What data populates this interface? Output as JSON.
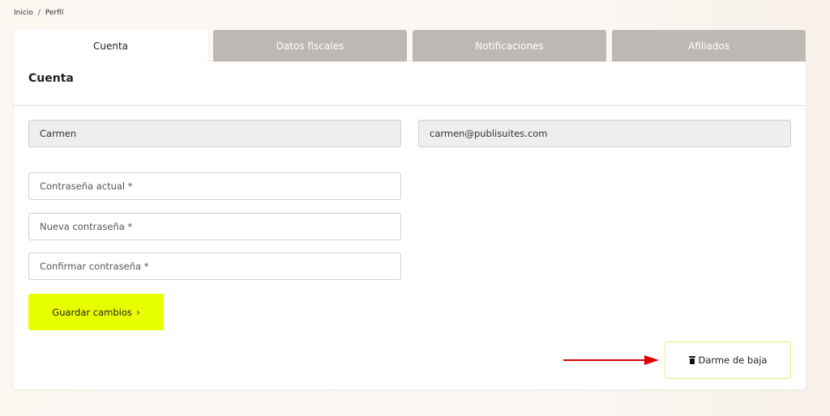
{
  "breadcrumb": {
    "home": "Inicio",
    "separator": "/",
    "current": "Perfil"
  },
  "tabs": [
    {
      "label": "Cuenta",
      "active": true
    },
    {
      "label": "Datos fiscales",
      "active": false
    },
    {
      "label": "Notificaciones",
      "active": false
    },
    {
      "label": "Afiliados",
      "active": false
    }
  ],
  "account": {
    "title": "Cuenta",
    "name_value": "Carmen",
    "email_value": "carmen@publisuites.com",
    "current_password_placeholder": "Contraseña actual *",
    "new_password_placeholder": "Nueva contraseña *",
    "confirm_password_placeholder": "Confirmar contraseña *",
    "save_label": "Guardar cambios",
    "save_chevron": "›",
    "unsubscribe_label": "Darme de baja"
  },
  "colors": {
    "accent_yellow": "#e8ff00",
    "tab_inactive": "#bcb8b3",
    "arrow_red": "#e00000"
  },
  "icons": {
    "unsubscribe": "trash-icon",
    "save": "chevron-right-icon",
    "annotation": "arrow-right-icon"
  }
}
